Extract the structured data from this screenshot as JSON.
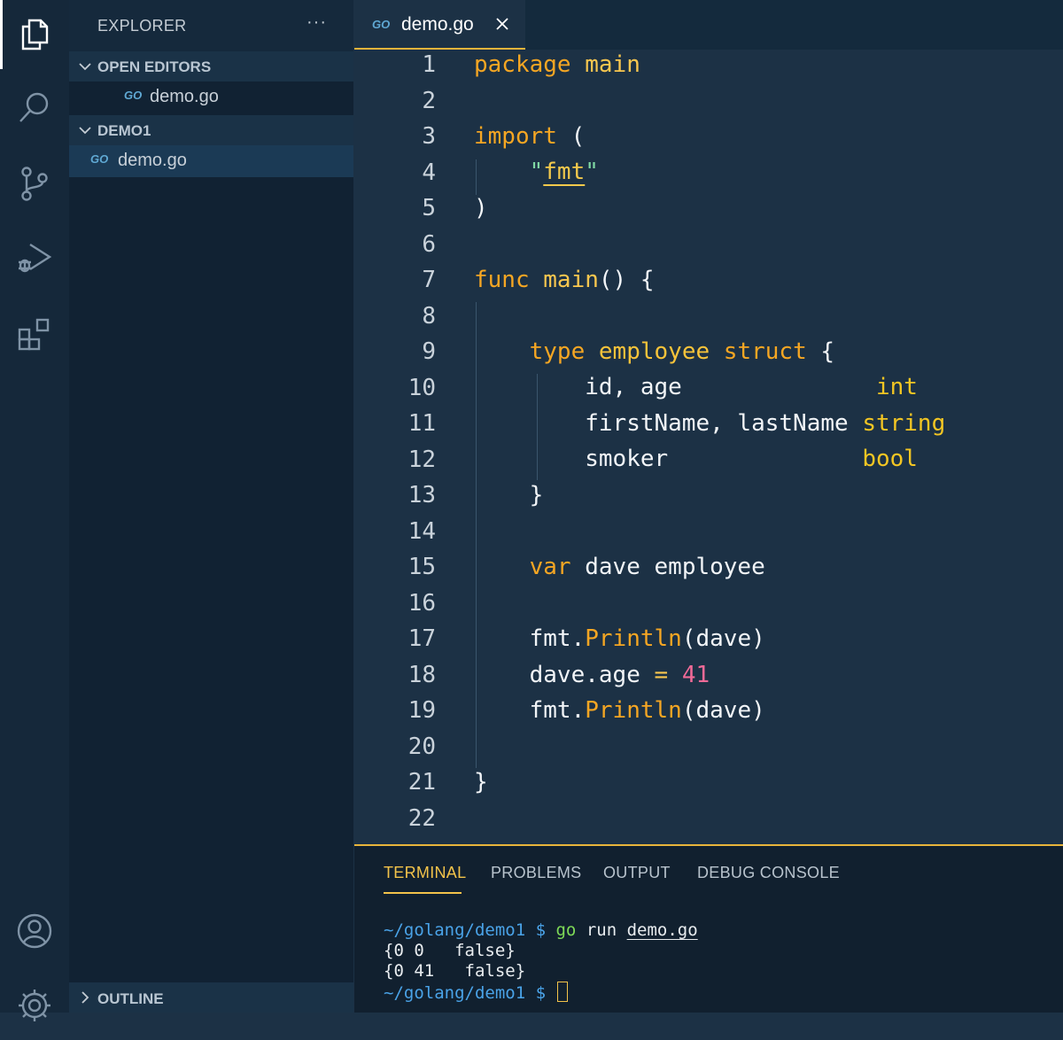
{
  "activity_bar": {
    "items": [
      "files-icon",
      "search-icon",
      "source-control-icon",
      "run-debug-icon",
      "extensions-icon"
    ],
    "bottom_items": [
      "account-icon",
      "settings-gear-icon"
    ]
  },
  "sidebar": {
    "title": "EXPLORER",
    "more": "···",
    "open_editors": {
      "label": "OPEN EDITORS",
      "files": [
        {
          "icon": "GO",
          "name": "demo.go"
        }
      ]
    },
    "folder": {
      "label": "DEMO1",
      "files": [
        {
          "icon": "GO",
          "name": "demo.go"
        }
      ]
    },
    "outline": {
      "label": "OUTLINE"
    }
  },
  "tabs": [
    {
      "icon": "GO",
      "name": "demo.go",
      "close": "×"
    }
  ],
  "editor": {
    "line_numbers": [
      "1",
      "2",
      "3",
      "4",
      "5",
      "6",
      "7",
      "8",
      "9",
      "10",
      "11",
      "12",
      "13",
      "14",
      "15",
      "16",
      "17",
      "18",
      "19",
      "20",
      "21",
      "22"
    ],
    "lines": {
      "l1": {
        "kw": "package",
        "name": "main"
      },
      "l3": {
        "kw": "import",
        "paren": "("
      },
      "l4": {
        "q1": "\"",
        "pkg": "fmt",
        "q2": "\""
      },
      "l5": {
        "paren": ")"
      },
      "l7": {
        "kw": "func",
        "name": "main",
        "rest": "() {"
      },
      "l9": {
        "kw": "type",
        "name": "employee",
        "kw2": "struct",
        "brace": "{"
      },
      "l10": {
        "fields": "id, age",
        "type": "int"
      },
      "l11": {
        "fields": "firstName, lastName",
        "type": "string"
      },
      "l12": {
        "fields": "smoker",
        "type": "bool"
      },
      "l13": {
        "brace": "}"
      },
      "l15": {
        "kw": "var",
        "rest": "dave employee"
      },
      "l17": {
        "pkg": "fmt.",
        "fn": "Println",
        "args": "(dave)"
      },
      "l18": {
        "lhs": "dave.age",
        "op": "=",
        "num": "41"
      },
      "l19": {
        "pkg": "fmt.",
        "fn": "Println",
        "args": "(dave)"
      },
      "l21": {
        "brace": "}"
      }
    }
  },
  "panel": {
    "tabs": [
      "TERMINAL",
      "PROBLEMS",
      "OUTPUT",
      "DEBUG CONSOLE"
    ],
    "active_tab": "TERMINAL",
    "terminal": {
      "prompt_path": "~/golang/demo1 $",
      "cmd_go": "go",
      "cmd_run": "run",
      "cmd_file": "demo.go",
      "out1": "{0 0   false}",
      "out2": "{0 41   false}",
      "prompt2": "~/golang/demo1 $"
    }
  }
}
